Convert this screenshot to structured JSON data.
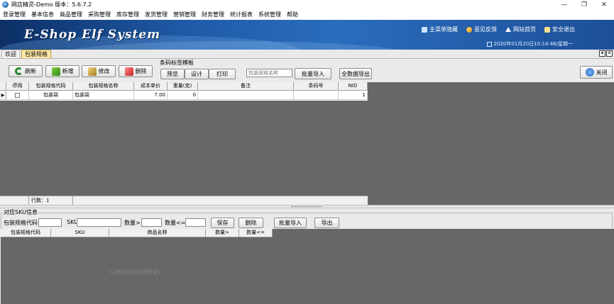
{
  "window": {
    "title": "网店精灵-Demo  版本：5.6.7.2",
    "minimize": "—",
    "restore": "❐",
    "close": "✕"
  },
  "menu": [
    "登录管理",
    "基本信息",
    "商品管理",
    "采购管理",
    "库存管理",
    "发货管理",
    "营销管理",
    "财务管理",
    "统计报表",
    "系统管理",
    "帮助"
  ],
  "banner": {
    "brand": "E-Shop Elf System",
    "links": {
      "main_menu": "主菜单隐藏",
      "feedback": "意见反馈",
      "home": "网站首页",
      "logout": "安全退出"
    },
    "datetime": "2020年01月20日10:14:46/星期一"
  },
  "tabs": {
    "welcome": "欢迎",
    "packaging": "包装规格",
    "ctrl_down": "▾",
    "ctrl_close": "✕"
  },
  "toolbar": {
    "refresh": "刷新",
    "new": "新增",
    "edit": "修改",
    "delete": "删除",
    "barcode_group": "条码标签模板",
    "preview": "预览",
    "design": "设计",
    "print": "打印",
    "search_placeholder": "包装规格名称",
    "batch_import": "批量导入",
    "export_all": "全数据导出",
    "close": "关闭"
  },
  "grid": {
    "columns": [
      "停用",
      "包装规格代码",
      "包装规格名称",
      "成本单价",
      "重量(克)",
      "备注",
      "条码号",
      "NID"
    ],
    "rows": [
      {
        "disabled": "",
        "code": "包装袋",
        "name": "包装袋",
        "price": "7.00",
        "weight": "0",
        "remark": "",
        "barcode": "",
        "nid": "1"
      }
    ],
    "row_count": "行数：1"
  },
  "sku": {
    "legend": "对应SKU信息",
    "code_label": "包装规格代码",
    "sku_label": "SKU",
    "qty_gt_label": "数量>",
    "qty_le_label": "数量<=",
    "save": "保存",
    "delete": "删除",
    "batch_import": "批量导入",
    "export": "导出",
    "columns": [
      "包装规格代码",
      "SKU",
      "商品名称",
      "数量>",
      "数量<="
    ],
    "empty_hint": "<没有可以显示的信息>"
  },
  "colors": {
    "banner_dark": "#0d2f66",
    "banner_mid": "#2a6dbd",
    "active_tab": "#ffe9a8",
    "grid_bg": "#676767"
  }
}
